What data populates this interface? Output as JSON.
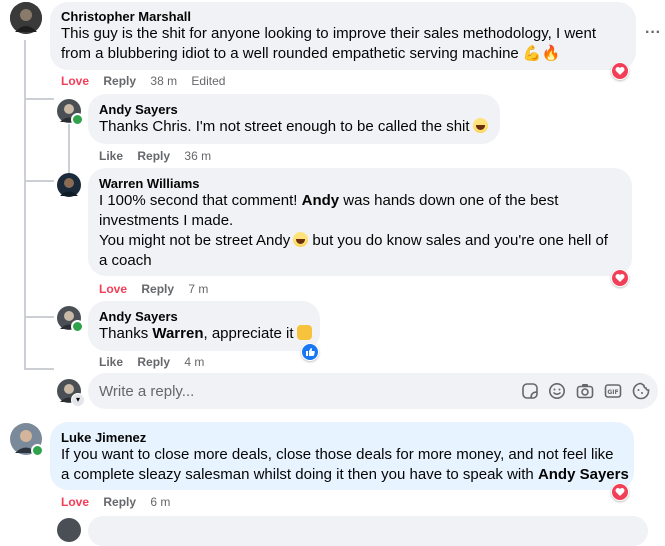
{
  "comments": [
    {
      "author": "Christopher Marshall",
      "lines": [
        "This guy is the shit for anyone looking to improve their sales methodology, I went",
        "from a blubbering idiot to a well rounded empathetic serving machine 💪🔥"
      ],
      "actions": {
        "love": "Love",
        "reply": "Reply",
        "time": "38 m",
        "edited": "Edited"
      }
    },
    {
      "author": "Andy Sayers",
      "text": "Thanks Chris. I'm not street enough to be called the shit",
      "actions": {
        "like": "Like",
        "reply": "Reply",
        "time": "36 m"
      }
    },
    {
      "author": "Warren Williams",
      "line1_pre": "I 100% second that comment! ",
      "line1_bold": "Andy",
      "line1_post": " was hands down one of the best",
      "line2": "investments I made.",
      "line3_pre": "You might not be street Andy",
      "line3_post": " but you do know sales and you're one hell of",
      "line4": "a coach",
      "actions": {
        "love": "Love",
        "reply": "Reply",
        "time": "7 m"
      }
    },
    {
      "author": "Andy Sayers",
      "text_pre": "Thanks ",
      "text_bold": "Warren",
      "text_post": ", appreciate it",
      "actions": {
        "like": "Like",
        "reply": "Reply",
        "time": "4 m"
      }
    },
    {
      "author": "Luke Jimenez",
      "line1": "If you want to close more deals, close those deals for more money, and not feel like",
      "line2_pre": "a complete sleazy salesman whilst doing it then you have to speak with ",
      "line2_bold": "Andy Sayers",
      "actions": {
        "love": "Love",
        "reply": "Reply",
        "time": "6 m"
      }
    }
  ],
  "reply_input": {
    "placeholder": "Write a reply..."
  },
  "more_menu": "···",
  "icons": [
    "more-icon",
    "love-reaction-icon",
    "like-reaction-icon",
    "sticker-icon",
    "emoji-icon",
    "camera-icon",
    "gif-icon",
    "avatar-sticker-icon"
  ],
  "colors": {
    "bubble": "#f0f2f5",
    "highlight_bubble": "#e7f3ff",
    "love": "#f33e58",
    "like": "#1877f2",
    "online": "#31a24c",
    "muted": "#65676b"
  }
}
